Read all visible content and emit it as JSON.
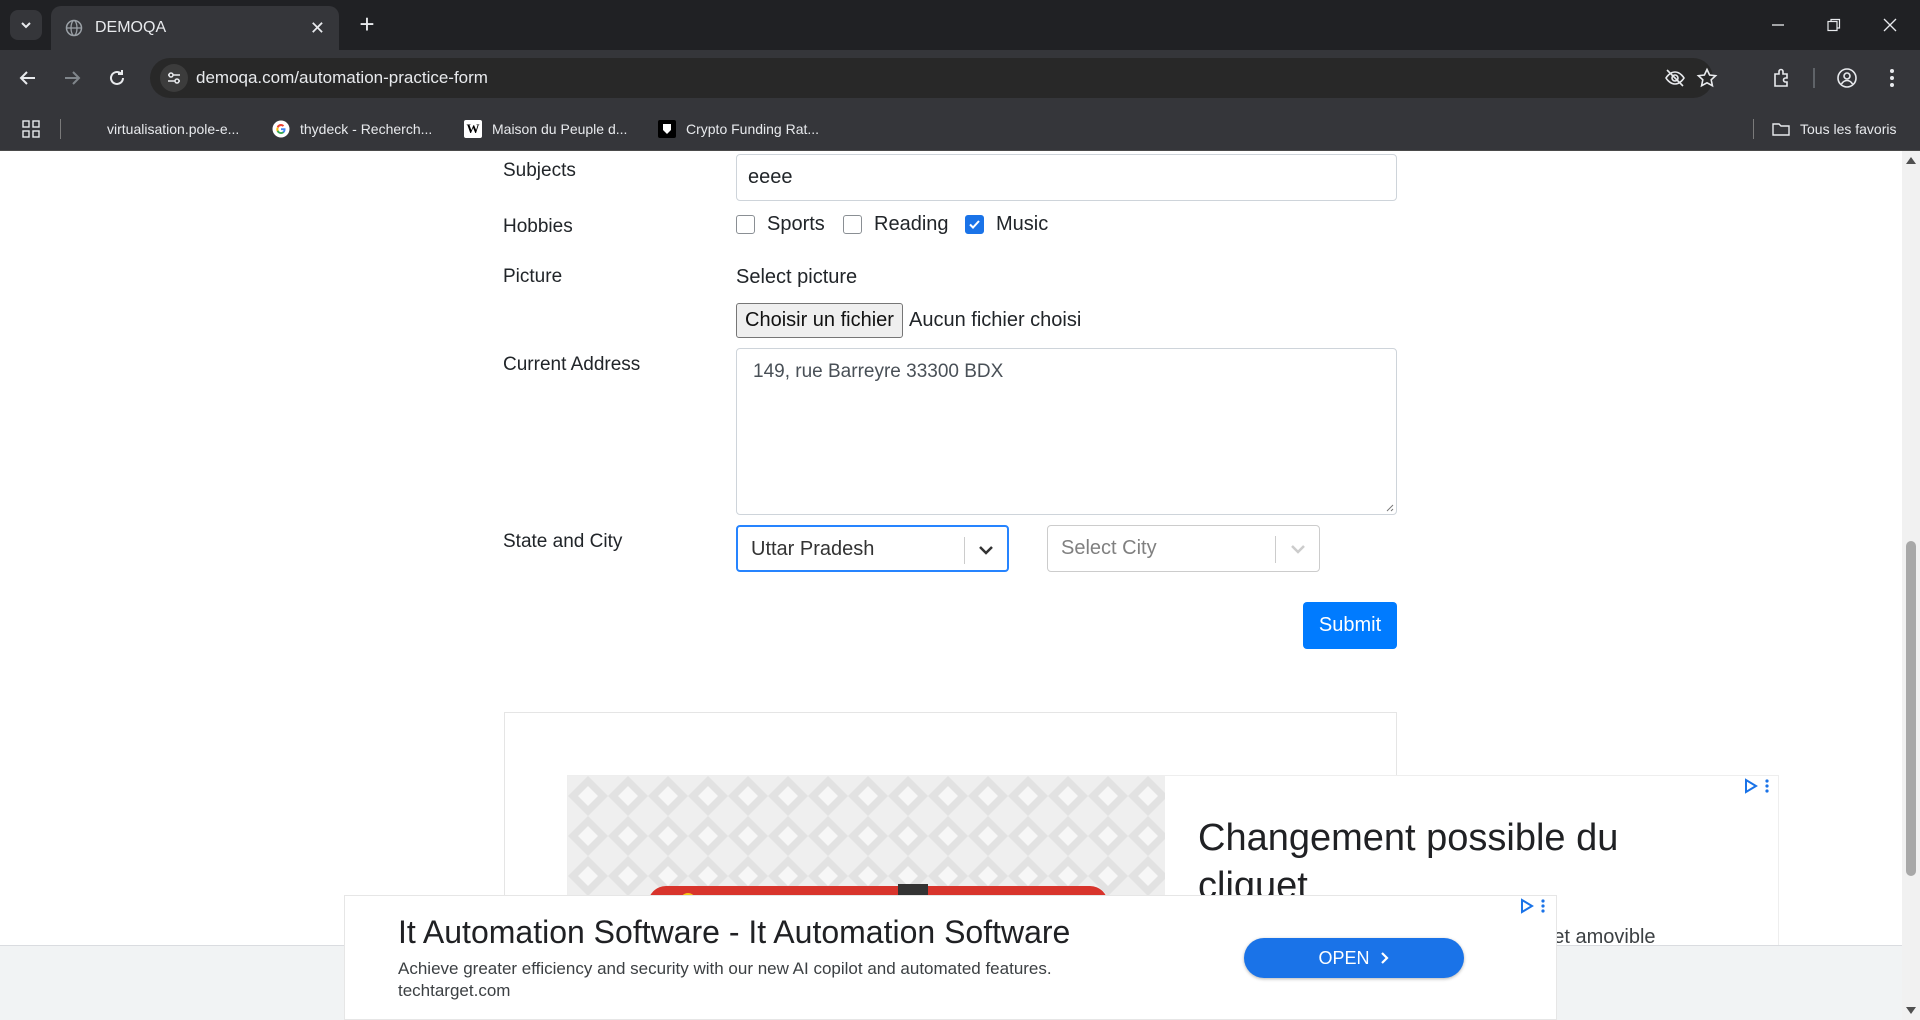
{
  "browser": {
    "tab_title": "DEMOQA",
    "url_host": "demoqa.com",
    "url_path": "/automation-practice-form",
    "bookmarks": [
      {
        "label": "virtualisation.pole-e...",
        "icon": "none"
      },
      {
        "label": "thydeck - Recherch...",
        "icon": "google-icon"
      },
      {
        "label": "Maison du Peuple d...",
        "icon": "wikipedia-icon"
      },
      {
        "label": "Crypto Funding Rat...",
        "icon": "crypto-icon"
      }
    ],
    "all_bookmarks_label": "Tous les favoris"
  },
  "form": {
    "subjects_label": "Subjects",
    "subjects_value": "eeee",
    "hobbies_label": "Hobbies",
    "hobbies": [
      {
        "label": "Sports",
        "checked": false
      },
      {
        "label": "Reading",
        "checked": false
      },
      {
        "label": "Music",
        "checked": true
      }
    ],
    "picture_label": "Picture",
    "select_picture_label": "Select picture",
    "file_button_label": "Choisir un fichier",
    "file_status": "Aucun fichier choisi",
    "address_label": "Current Address",
    "address_value": "149, rue Barreyre 33300 BDX",
    "state_city_label": "State and City",
    "state_value": "Uttar Pradesh",
    "city_placeholder": "Select City",
    "submit_label": "Submit"
  },
  "ads": {
    "image_ad_headline": "Changement possible du cliquet",
    "image_ad_subtext": "quet amovible",
    "banner_title": "It Automation Software - It Automation Software",
    "banner_desc": "Achieve greater efficiency and security with our new AI copilot and automated features.",
    "banner_domain": "techtarget.com",
    "banner_button": "OPEN"
  },
  "colors": {
    "primary": "#007bff",
    "checkbox_checked": "#1a73e8",
    "focus_border": "#2684ff"
  }
}
